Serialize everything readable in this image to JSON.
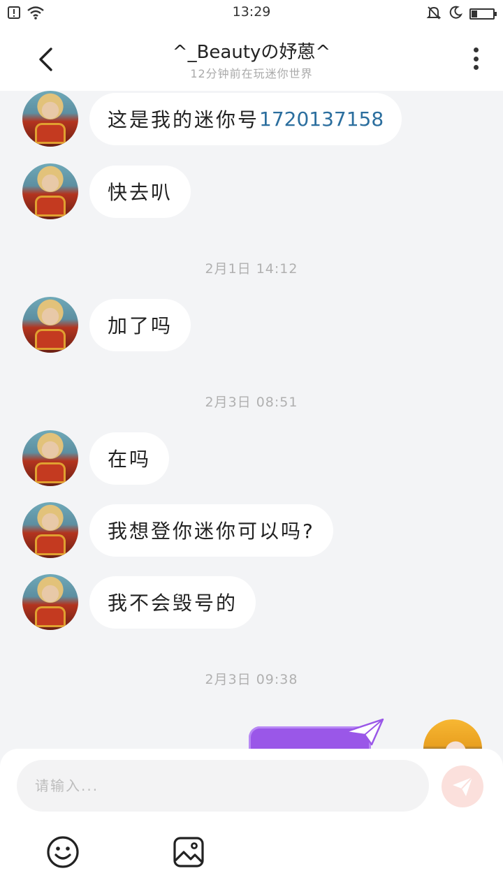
{
  "status_bar": {
    "time": "13:29",
    "battery_level": 0.25
  },
  "header": {
    "title": "^_Beautyの妤蒽^",
    "subtitle": "12分钟前在玩迷你世界"
  },
  "messages": [
    {
      "type": "text",
      "text": "这是我的迷你号",
      "number": "1720137158"
    },
    {
      "type": "text",
      "text": "快去叭"
    },
    {
      "type": "time",
      "text": "2月1日 14:12"
    },
    {
      "type": "text",
      "text": "加了吗"
    },
    {
      "type": "time",
      "text": "2月3日 08:51"
    },
    {
      "type": "text",
      "text": "在吗"
    },
    {
      "type": "text",
      "text": "我想登你迷你可以吗?"
    },
    {
      "type": "text",
      "text": "我不会毁号的"
    },
    {
      "type": "time",
      "text": "2月3日 09:38"
    }
  ],
  "input": {
    "placeholder": "请输入..."
  },
  "colors": {
    "background": "#f3f4f6",
    "bubble": "#ffffff",
    "link_number": "#2b6e9e",
    "send_button": "#fbe0dc",
    "purple_card": "#9a57e8"
  }
}
